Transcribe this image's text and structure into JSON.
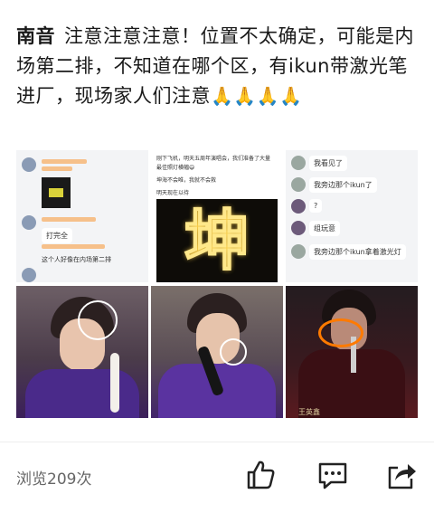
{
  "post": {
    "author": "南音",
    "text": "注意注意注意！位置不太确定，可能是内场第二排，不知道在哪个区，有ikun带激光笔进厂，现场家人们注意",
    "emoji": "🙏🙏🙏🙏"
  },
  "images": {
    "chat1": {
      "bubble1": "打完全",
      "bubble2": "这个人好像在内场第二排"
    },
    "chat2": {
      "line1": "刚下飞机，明天五周年演唱会，我们准备了大量",
      "line2": "最佳照灯横幅😄",
      "line3": "坤海不会唯，我就不会救",
      "line4": "明天现在以待",
      "sign": "坤"
    },
    "chat3": {
      "m1": "我看见了",
      "m2": "我旁边那个ikun了",
      "m3": "?",
      "m4": "组玩意",
      "m5": "我旁边那个ikun拿着激光灯"
    },
    "photo6_caption": "王英鑫"
  },
  "footer": {
    "views": "浏览209次"
  },
  "colors": {
    "text": "#1a1a1a",
    "muted": "#666666",
    "annotation": "#ff7a00",
    "sign_glow": "#ffe88a"
  }
}
